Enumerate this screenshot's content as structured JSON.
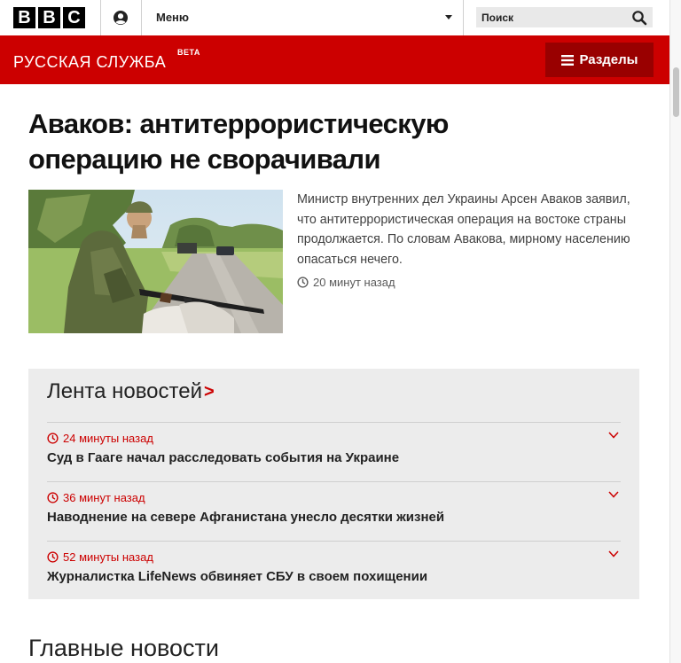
{
  "header": {
    "logo_letters": [
      "B",
      "B",
      "C"
    ],
    "menu_label": "Меню",
    "search_placeholder": "Поиск"
  },
  "band": {
    "service_title": "РУССКАЯ СЛУЖБА",
    "beta_label": "BETA",
    "sections_label": "Разделы"
  },
  "colors": {
    "brand_red": "#cc0000",
    "dark_red": "#990000",
    "feed_bg": "#ececec"
  },
  "main": {
    "headline": "Аваков: антитеррористическую операцию не сворачивали",
    "summary": "Министр внутренних дел Украины Арсен Аваков заявил, что антитеррористическая операция на востоке страны продолжается. По словам Авакова, мирному населению опасаться нечего.",
    "timestamp": "20 минут назад"
  },
  "feed": {
    "title": "Лента новостей",
    "chevron": ">",
    "items": [
      {
        "time": "24 минуты назад",
        "title": "Суд в Гааге начал расследовать события на Украине"
      },
      {
        "time": "36 минут назад",
        "title": "Наводнение на севере Афганистана унесло десятки жизней"
      },
      {
        "time": "52 минуты назад",
        "title": "Журналистка LifeNews обвиняет СБУ в своем похищении"
      }
    ]
  },
  "top_stories": {
    "title": "Главные новости"
  },
  "icons": {
    "user": "user-icon",
    "search": "search-icon",
    "menu": "hamburger-icon",
    "clock": "clock-icon",
    "expand": "chevron-down-icon"
  }
}
